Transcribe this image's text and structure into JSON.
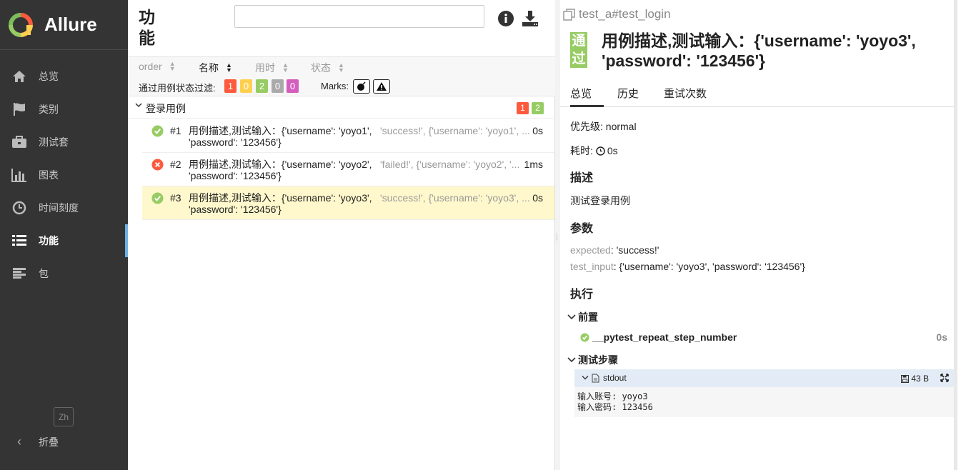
{
  "sidebar": {
    "brand": "Allure",
    "items": [
      {
        "label": "总览",
        "icon": "home-icon"
      },
      {
        "label": "类别",
        "icon": "flag-icon"
      },
      {
        "label": "测试套",
        "icon": "briefcase-icon"
      },
      {
        "label": "图表",
        "icon": "bar-chart-icon"
      },
      {
        "label": "时间刻度",
        "icon": "clock-icon"
      },
      {
        "label": "功能",
        "icon": "list-icon",
        "active": true
      },
      {
        "label": "包",
        "icon": "align-left-icon"
      }
    ],
    "lang": "Zh",
    "collapse": "折叠"
  },
  "middle": {
    "title_line1": "功",
    "title_line2": "能",
    "search_value": "",
    "sort": {
      "order": "order",
      "name": "名称",
      "duration": "用时",
      "status": "状态"
    },
    "filter_label": "通过用例状态过滤:",
    "filter_counts": [
      "1",
      "0",
      "2",
      "0",
      "0"
    ],
    "marks_label": "Marks:",
    "group": {
      "name": "登录用例",
      "failed": "1",
      "passed": "2"
    },
    "rows": [
      {
        "num": "#1",
        "name": "用例描述,测试输入：{'username': 'yoyo1', 'password': '123456'}",
        "params": "'success!', {'username': 'yoyo1', ...",
        "duration": "0s",
        "status": "passed"
      },
      {
        "num": "#2",
        "name": "用例描述,测试输入：{'username': 'yoyo2', 'password': '123456'}",
        "params": "'failed!', {'username': 'yoyo2', '...",
        "duration": "1ms",
        "status": "failed"
      },
      {
        "num": "#3",
        "name": "用例描述,测试输入：{'username': 'yoyo3', 'password': '123456'}",
        "params": "'success!', {'username': 'yoyo3', ...",
        "duration": "0s",
        "status": "passed"
      }
    ]
  },
  "detail": {
    "crumb": "test_a#test_login",
    "status_l1": "通",
    "status_l2": "过",
    "title": "用例描述,测试输入：{'username': 'yoyo3', 'password': '123456'}",
    "tabs": [
      "总览",
      "历史",
      "重试次数"
    ],
    "priority": "优先级: normal",
    "duration_label": "耗时:",
    "duration": "0s",
    "desc_heading": "描述",
    "description": "测试登录用例",
    "params_heading": "参数",
    "params": [
      {
        "key": "expected",
        "value": "'success!'"
      },
      {
        "key": "test_input",
        "value": "{'username': 'yoyo3', 'password': '123456'}"
      }
    ],
    "exec_heading": "执行",
    "setup_heading": "前置",
    "setup_step": "__pytest_repeat_step_number",
    "setup_duration": "0s",
    "steps_heading": "测试步骤",
    "attachment_name": "stdout",
    "attachment_size": "43 B",
    "stdout_line1": "输入账号: yoyo3",
    "stdout_line2": "输入密码: 123456"
  },
  "colors": {
    "sidebar_bg": "#343434",
    "active_marker": "#6fb1e6",
    "failed": "#fd5a3e",
    "broken": "#ffd050",
    "passed": "#97cc64",
    "skipped": "#aaaaaa",
    "unknown": "#d35ebe",
    "selected_row": "#fff8cc"
  }
}
